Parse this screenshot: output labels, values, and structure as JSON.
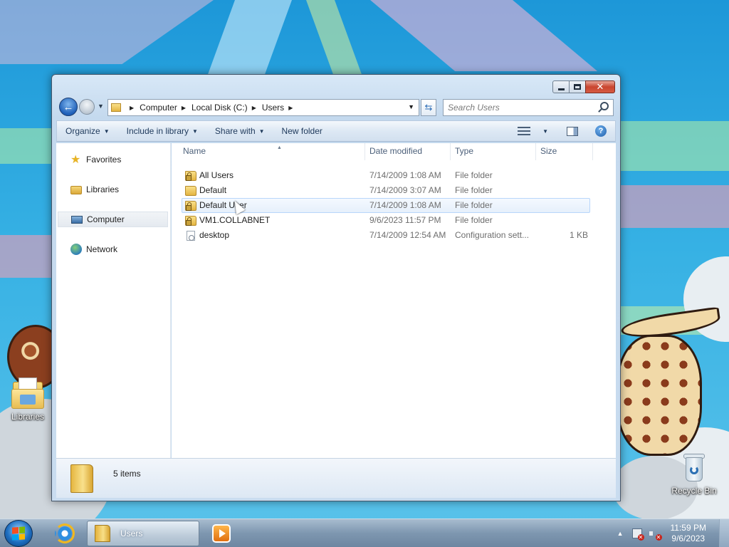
{
  "window": {
    "address": {
      "crumbs": [
        "Computer",
        "Local Disk (C:)",
        "Users"
      ]
    },
    "search_placeholder": "Search Users",
    "toolbar": {
      "organize": "Organize",
      "include_in_library": "Include in library",
      "share_with": "Share with",
      "new_folder": "New folder"
    },
    "nav": {
      "favorites": "Favorites",
      "libraries": "Libraries",
      "computer": "Computer",
      "network": "Network"
    },
    "columns": {
      "name": "Name",
      "date_modified": "Date modified",
      "type": "Type",
      "size": "Size"
    },
    "files": [
      {
        "name": "All Users",
        "date": "7/14/2009 1:08 AM",
        "type": "File folder",
        "size": "",
        "icon": "locked-folder-icon"
      },
      {
        "name": "Default",
        "date": "7/14/2009 3:07 AM",
        "type": "File folder",
        "size": "",
        "icon": "folder-icon"
      },
      {
        "name": "Default User",
        "date": "7/14/2009 1:08 AM",
        "type": "File folder",
        "size": "",
        "icon": "locked-folder-icon"
      },
      {
        "name": "VM1.COLLABNET",
        "date": "9/6/2023 11:57 PM",
        "type": "File folder",
        "size": "",
        "icon": "locked-folder-icon"
      },
      {
        "name": "desktop",
        "date": "7/14/2009 12:54 AM",
        "type": "Configuration sett...",
        "size": "1 KB",
        "icon": "config-file-icon"
      }
    ],
    "details": {
      "item_count": "5 items"
    }
  },
  "desktop": {
    "libraries_label": "Libraries",
    "recycle_bin_label": "Recycle Bin"
  },
  "taskbar": {
    "users_button": "Users",
    "time": "11:59 PM",
    "date": "9/6/2023"
  },
  "colors": {
    "selection_border": "#b8d6fb",
    "close_red": "#c9452f",
    "folder_yellow": "#f9e08a"
  }
}
